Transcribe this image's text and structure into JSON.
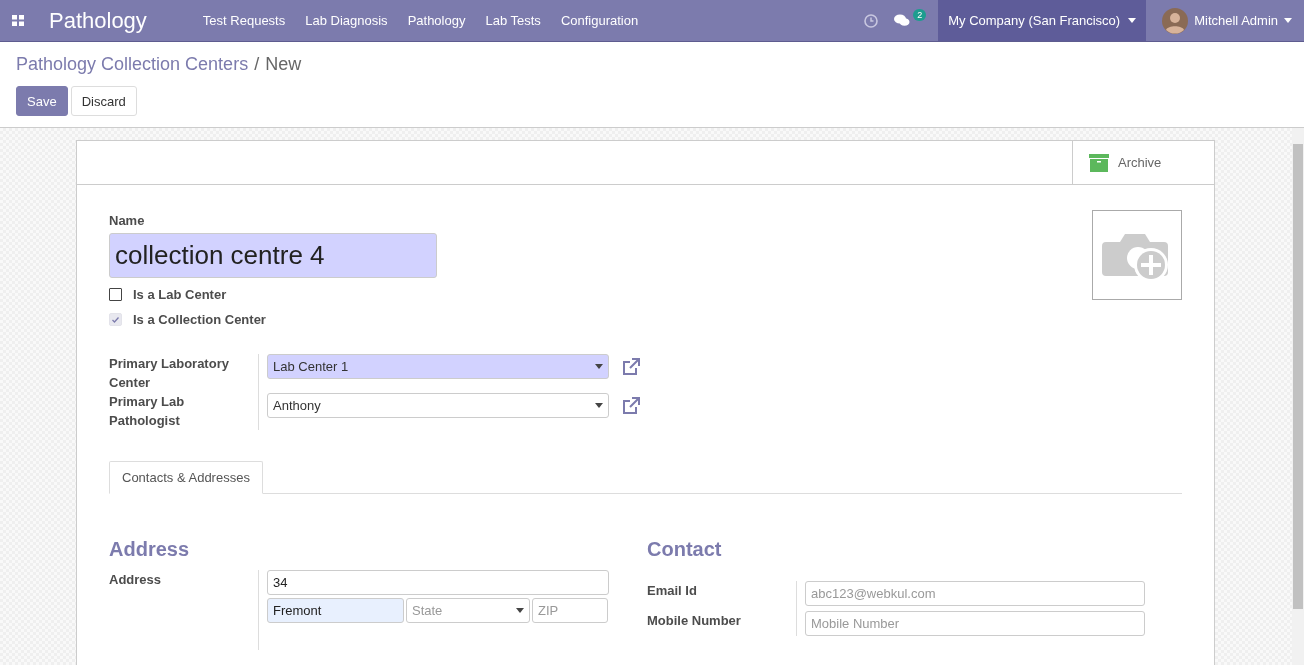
{
  "navbar": {
    "app_name": "Pathology",
    "menu": [
      "Test Requests",
      "Lab Diagnosis",
      "Pathology",
      "Lab Tests",
      "Configuration"
    ],
    "messages_count": "2",
    "company": "My Company (San Francisco)",
    "user": "Mitchell Admin"
  },
  "breadcrumb": {
    "parent": "Pathology Collection Centers",
    "separator": "/",
    "current": "New"
  },
  "buttons": {
    "save": "Save",
    "discard": "Discard"
  },
  "archive": "Archive",
  "name": {
    "label": "Name",
    "value": "collection centre 4"
  },
  "checkboxes": [
    {
      "label": "Is a Lab Center",
      "checked": false,
      "disabled": false
    },
    {
      "label": "Is a Collection Center",
      "checked": true,
      "disabled": true
    }
  ],
  "relations": [
    {
      "label": "Primary Laboratory Center",
      "value": "Lab Center 1",
      "required": true
    },
    {
      "label": "Primary Lab Pathologist",
      "value": "Anthony",
      "required": false
    }
  ],
  "tabs": [
    {
      "label": "Contacts & Addresses",
      "selected": true
    }
  ],
  "address": {
    "title": "Address",
    "label": "Address",
    "street": "34",
    "city": "Fremont",
    "state_placeholder": "State",
    "zip_placeholder": "ZIP"
  },
  "contact": {
    "title": "Contact",
    "fields": [
      {
        "label": "Email Id",
        "placeholder": "abc123@webkul.com"
      },
      {
        "label": "Mobile Number",
        "placeholder": "Mobile Number"
      }
    ]
  }
}
